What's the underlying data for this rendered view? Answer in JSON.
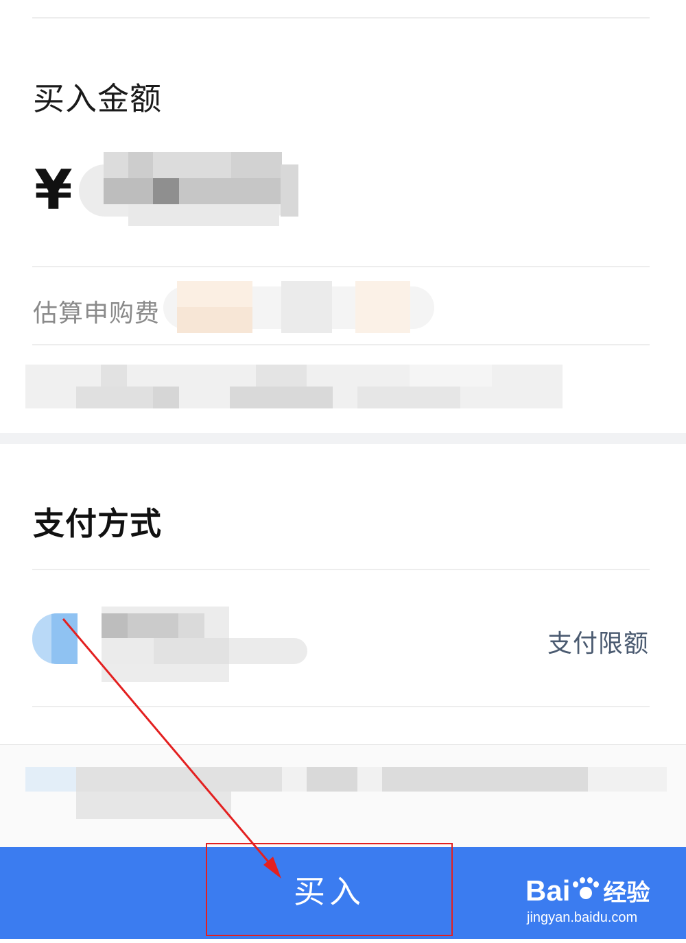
{
  "amount_section": {
    "title": "买入金额",
    "currency_symbol": "¥",
    "amount_value_obscured": true
  },
  "fee_row": {
    "label": "估算申购费",
    "value_obscured": true
  },
  "payment_section": {
    "title": "支付方式",
    "method_name_obscured": true,
    "limit_link": "支付限额"
  },
  "footer": {
    "buy_button_label": "买入"
  },
  "watermark": {
    "brand": "Bai",
    "brand_suffix": "经验",
    "url": "jingyan.baidu.com"
  },
  "colors": {
    "primary_blue": "#3b7cf0",
    "annotation_red": "#e32020",
    "divider": "#ededed",
    "muted_text": "#8a8a8a"
  },
  "icons": {
    "payment_method_icon": "wechat-pay-icon",
    "annotation": "red-arrow-icon"
  }
}
